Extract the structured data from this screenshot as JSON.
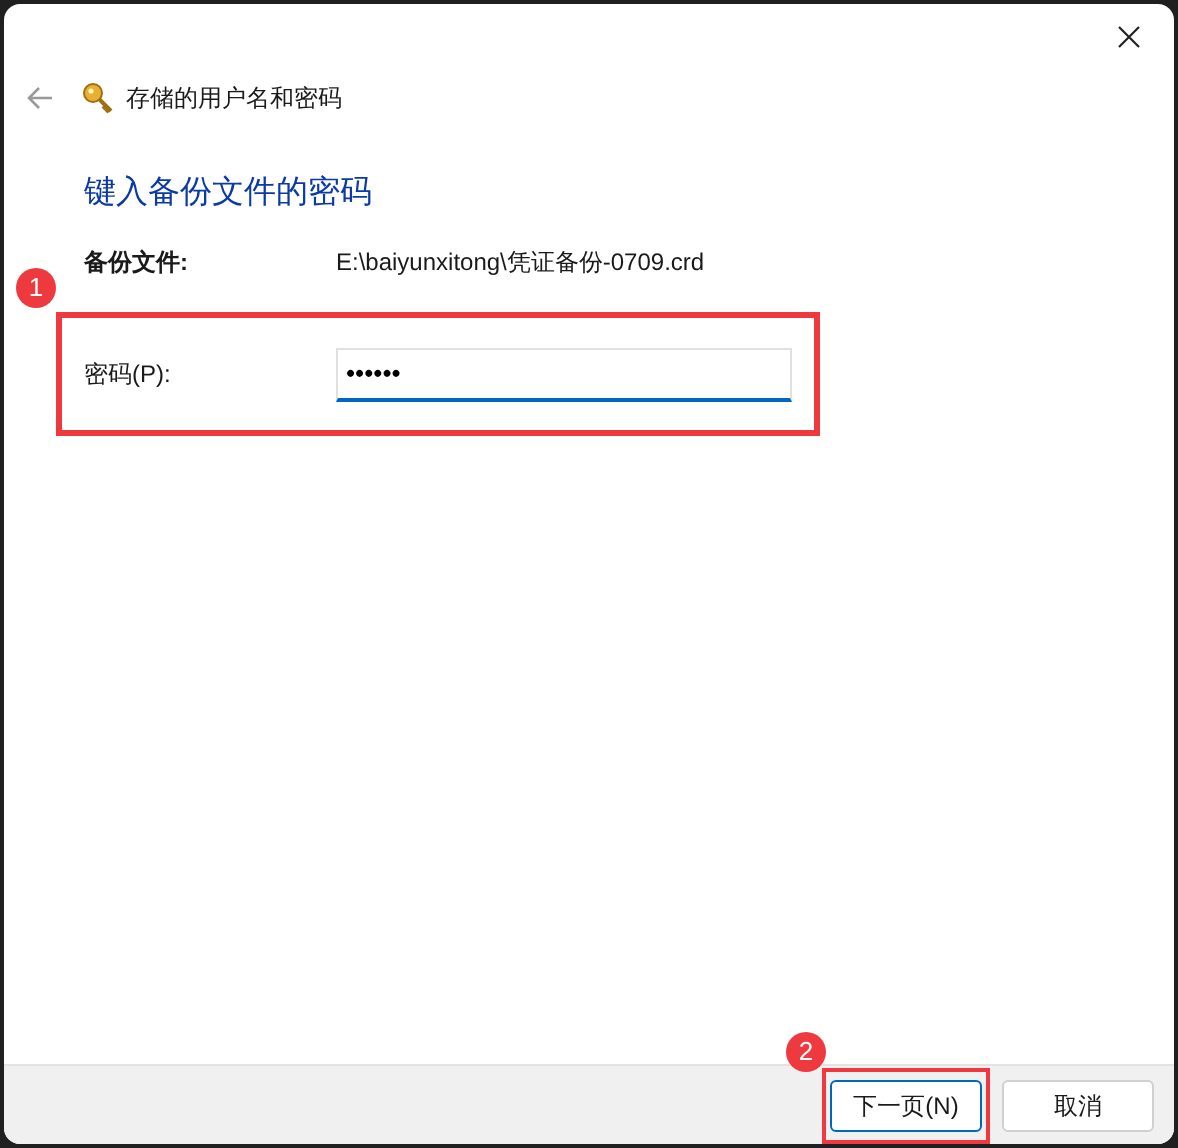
{
  "window": {
    "title": "存储的用户名和密码"
  },
  "heading": "键入备份文件的密码",
  "backup_file": {
    "label": "备份文件:",
    "value": "E:\\baiyunxitong\\凭证备份-0709.crd"
  },
  "password": {
    "label": "密码(P):",
    "value": "••••••"
  },
  "annotations": [
    {
      "number": "1"
    },
    {
      "number": "2"
    }
  ],
  "buttons": [
    {
      "label": "下一页(N)",
      "default": true
    },
    {
      "label": "取消",
      "default": false
    }
  ]
}
